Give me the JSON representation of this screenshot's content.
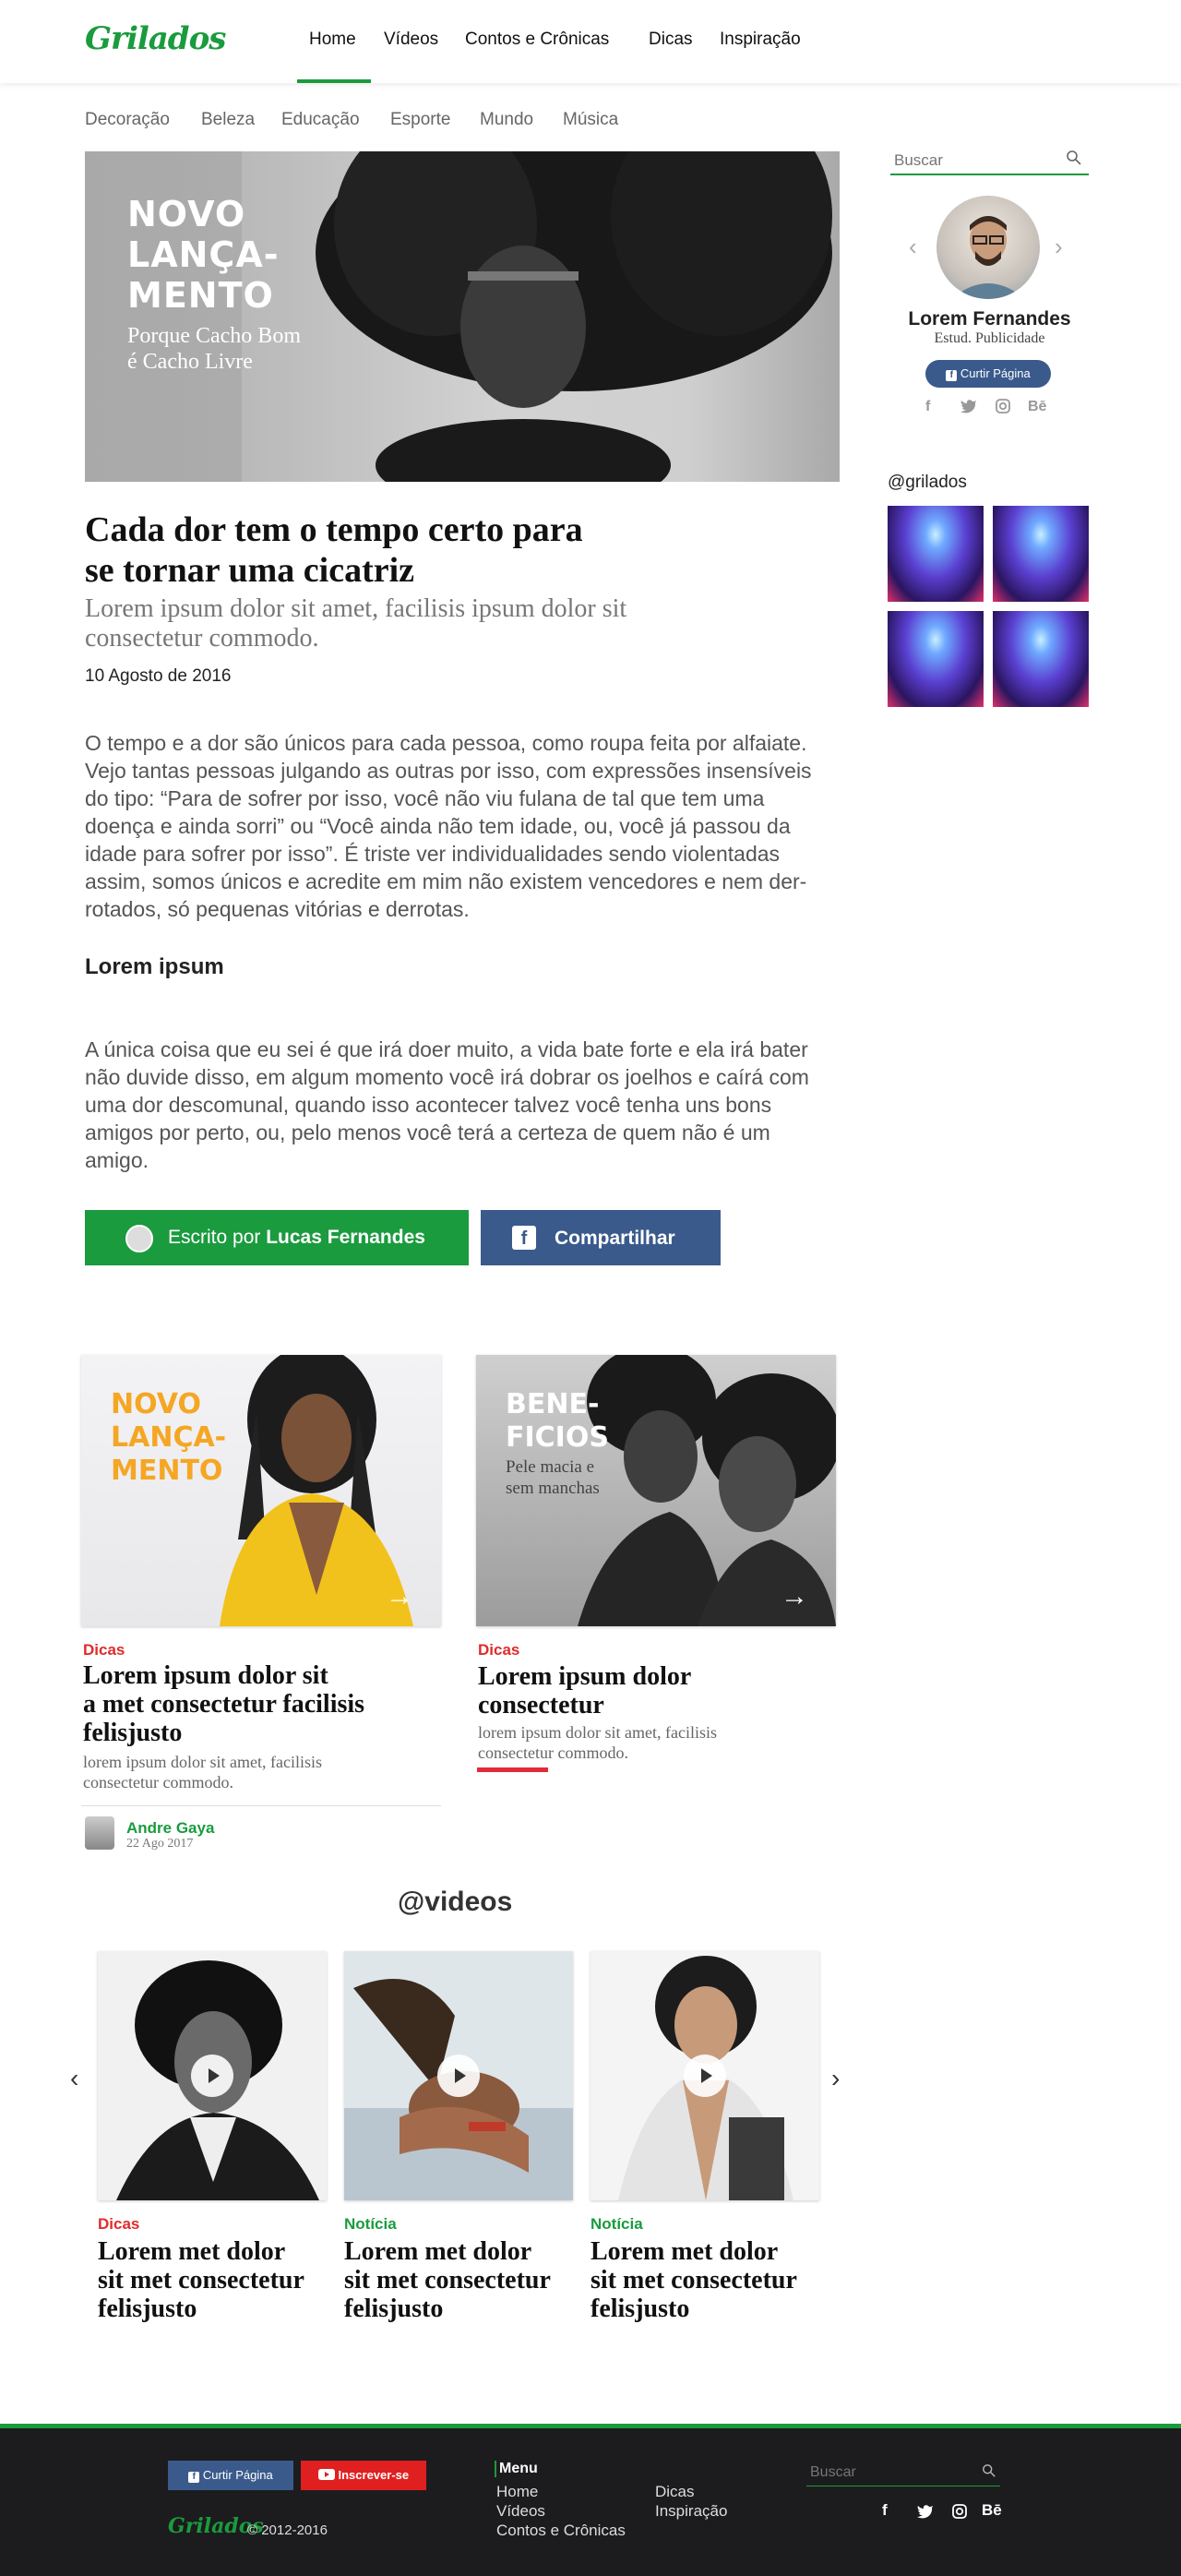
{
  "header": {
    "logo": "Grilados",
    "nav": [
      "Home",
      "Vídeos",
      "Contos e Crônicas",
      "Dicas",
      "Inspiração"
    ]
  },
  "subnav": [
    "Decoração",
    "Beleza",
    "Educação",
    "Esporte",
    "Mundo",
    "Música"
  ],
  "hero": {
    "title_lines": [
      "NOVO",
      "LANÇA-",
      "MENTO"
    ],
    "subtitle_lines": [
      "Porque Cacho Bom",
      "é Cacho Livre"
    ]
  },
  "article": {
    "title_lines": [
      "Cada dor tem o tempo certo para",
      "se tornar uma cicatriz"
    ],
    "subtitle_lines": [
      "Lorem ipsum dolor sit amet, facilisis ipsum dolor sit",
      "consectetur commodo."
    ],
    "date": "10 Agosto de 2016",
    "paragraph1_lines": [
      "O tempo e a dor são únicos para cada pessoa, como roupa feita por alfaiate.",
      "Vejo tantas pessoas julgando as outras por isso, com expressões insensíveis",
      "do tipo: “Para de sofrer por isso, você não viu fulana de tal que tem uma",
      "doença e ainda sorri” ou “Você ainda não tem idade, ou, você já passou da",
      "idade para sofrer por isso”. É triste ver individualidades sendo violentadas",
      "assim, somos únicos e acredite em mim não existem vencedores e nem der-",
      "rotados, só pequenas vitórias e derrotas."
    ],
    "section_heading": "Lorem ipsum",
    "paragraph2_lines": [
      "A única coisa que eu sei é que irá doer muito, a vida bate forte e ela irá bater",
      "não duvide disso, em algum momento você irá dobrar os joelhos e caírá com",
      "uma dor descomunal, quando isso acontecer talvez você tenha uns bons",
      "amigos por perto, ou, pelo menos você terá a certeza de quem não é um",
      "amigo."
    ],
    "author_prefix": "Escrito por",
    "author_name": "Lucas Fernandes",
    "share_label": "Compartilhar"
  },
  "sidebar": {
    "search_placeholder": "Buscar",
    "profile_name": "Lorem Fernandes",
    "profile_role": "Estud. Publicidade",
    "like_label": "Curtir Página",
    "social": [
      "f",
      "t",
      "ig",
      "Bē"
    ],
    "instagram_handle": "@grilados"
  },
  "cards": [
    {
      "overlay_lines": [
        "NOVO",
        "LANÇA-",
        "MENTO"
      ],
      "category": "Dicas",
      "title_lines": [
        "Lorem ipsum dolor sit",
        "a met consectetur facilisis",
        "felisjusto"
      ],
      "desc_lines": [
        "lorem ipsum dolor sit amet, facilisis",
        "consectetur commodo."
      ],
      "author_name": "Andre Gaya",
      "author_date": "22 Ago 2017"
    },
    {
      "overlay_lines": [
        "BENE-",
        "FICIOS"
      ],
      "overlay_sub_lines": [
        "Pele macia e",
        "sem manchas"
      ],
      "category": "Dicas",
      "title_lines": [
        "Lorem ipsum dolor",
        "consectetur"
      ],
      "desc_lines": [
        "lorem ipsum dolor sit amet, facilisis",
        "consectetur commodo."
      ]
    }
  ],
  "videos": {
    "title": "@videos",
    "items": [
      {
        "category": "Dicas",
        "title_lines": [
          "Lorem met dolor",
          "sit met consectetur",
          "felisjusto"
        ]
      },
      {
        "category": "Notícia",
        "title_lines": [
          "Lorem met dolor",
          "sit met consectetur",
          "felisjusto"
        ]
      },
      {
        "category": "Notícia",
        "title_lines": [
          "Lorem met dolor",
          "sit met consectetur",
          "felisjusto"
        ]
      }
    ]
  },
  "footer": {
    "like_label": "Curtir Página",
    "subscribe_label": "Inscrever-se",
    "logo": "Grilados",
    "copyright": "© 2012-2016",
    "menu_title": "Menu",
    "menu_col1": [
      "Home",
      "Vídeos",
      "Contos e Crônicas"
    ],
    "menu_col2": [
      "Dicas",
      "Inspiração"
    ],
    "search_placeholder": "Buscar",
    "social": [
      "f",
      "t",
      "ig",
      "Bē"
    ]
  },
  "colors": {
    "brand_green": "#1a9b3e",
    "facebook_blue": "#3a5a8c",
    "category_red": "#e02b2b",
    "overlay_orange": "#f5a623"
  }
}
